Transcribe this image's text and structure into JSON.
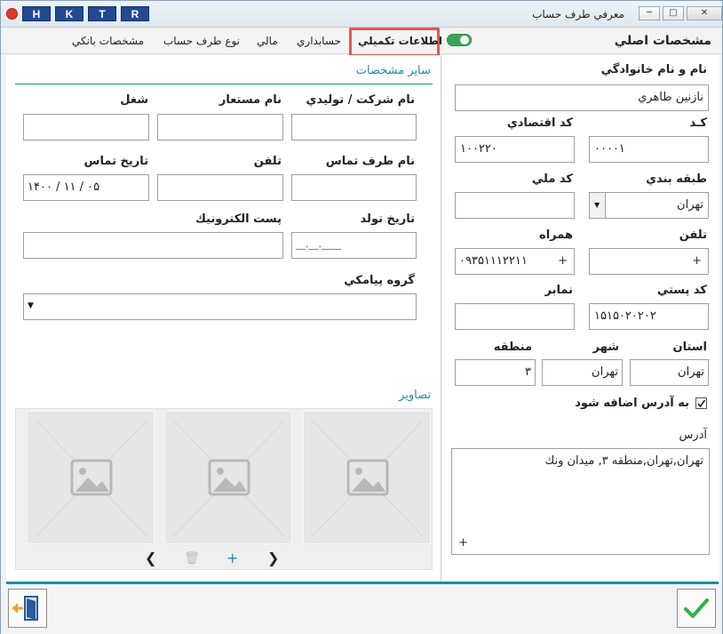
{
  "window": {
    "title": "معرفي طرف حساب",
    "hk_buttons": [
      "H",
      "K",
      "T",
      "R"
    ],
    "sys_min": "─",
    "sys_max": "□",
    "sys_close": "✕"
  },
  "tabs": {
    "main": "مشخصات اصلي",
    "extra": "اطلاعات تكميلي",
    "accounting": "حسابداري",
    "financial": "مالي",
    "account_type": "نوع طرف حساب",
    "bank": "مشخصات بانكي"
  },
  "right": {
    "fullname_label": "نام و نام خانوادگي",
    "fullname_value": "نازنين طاهري",
    "code_label": "كـد",
    "code_value": "۰۰۰۰۱",
    "econ_code_label": "كد اقتصادي",
    "econ_code_value": "۱۰۰۲۲۰",
    "category_label": "طبقه بندي",
    "category_value": "تهران",
    "national_code_label": "كد ملي",
    "national_code_value": "",
    "phone_label": "تلفن",
    "phone_value": "+",
    "mobile_label": "همراه",
    "mobile_value": "۰۹۳۵۱۱۱۲۲۱۱",
    "mobile_plus": "+",
    "postal_label": "كد پستي",
    "postal_value": "۱۵۱۵۰۲۰۲۰۲",
    "fax_label": "نمابر",
    "fax_value": "",
    "province_label": "استان",
    "province_value": "تهران",
    "city_label": "شهر",
    "city_value": "تهران",
    "district_label": "منطقه",
    "district_value": "۳",
    "add_to_address_label": "به آدرس اضافه شود",
    "add_to_address_checked": true,
    "address_label": "آدرس",
    "address_value": "تهران,تهران,منطقه ۳, ميدان ونك",
    "address_plus": "+"
  },
  "left": {
    "other_section": "ساير مشخصات",
    "company_label": "نام شركت / توليدي",
    "company_value": "",
    "alias_label": "نام مستعار",
    "alias_value": "",
    "job_label": "شغل",
    "job_value": "",
    "contact_name_label": "نام طرف تماس",
    "contact_name_value": "",
    "contact_phone_label": "تلفن",
    "contact_phone_value": "",
    "contact_date_label": "تاريخ تماس",
    "contact_date_value": "۱۴۰۰ / ۱۱ / ۰۵",
    "birth_date_label": "تاريخ تولد",
    "birth_date_value": "__.__.____",
    "email_label": "پست الكترونيك",
    "email_value": "",
    "sms_group_label": "گروه پيامكي",
    "sms_group_value": "",
    "images_section": "تصاوير"
  },
  "colors": {
    "accent": "#1b8fa3",
    "tab_highlight": "#e8534c",
    "toggle_on": "#3aa55a",
    "confirm": "#2db34a",
    "exit_arrow": "#f0a020",
    "hk_button": "#214a91"
  },
  "icons": {
    "confirm": "checkmark-icon",
    "exit": "exit-door-icon",
    "image": "image-placeholder-icon",
    "prev": "chevron-left-icon",
    "next": "chevron-right-icon",
    "delete": "trash-icon",
    "add": "plus-icon"
  }
}
